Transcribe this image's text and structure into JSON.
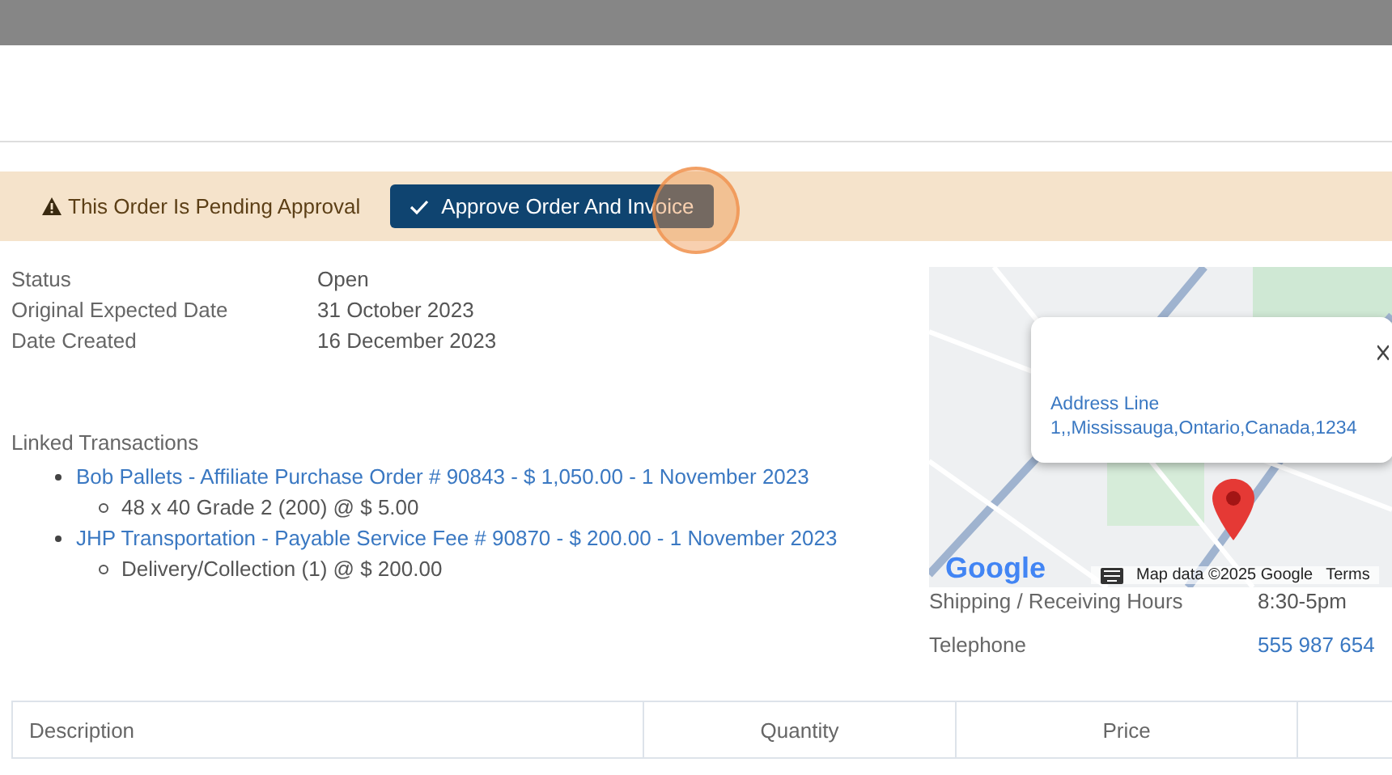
{
  "banner": {
    "message": "This Order Is Pending Approval",
    "button": "Approve Order And Invoice"
  },
  "details": [
    {
      "label": "Status",
      "value": "Open"
    },
    {
      "label": "Original Expected Date",
      "value": "31 October 2023"
    },
    {
      "label": "Date Created",
      "value": "16 December 2023"
    }
  ],
  "linked_transactions": {
    "title": "Linked Transactions",
    "items": [
      {
        "link": "Bob Pallets - Affiliate Purchase Order # 90843 - $ 1,050.00 - 1 November 2023",
        "children": [
          "48 x 40 Grade 2 (200) @ $ 5.00"
        ]
      },
      {
        "link": "JHP Transportation - Payable Service Fee # 90870 - $ 200.00 - 1 November 2023",
        "children": [
          "Delivery/Collection (1) @ $ 200.00"
        ]
      }
    ]
  },
  "map": {
    "popup_address": [
      "Address Line",
      "1,,Mississauga,Ontario,Canada,1234"
    ],
    "logo": "Google",
    "attribution": "Map data ©2025 Google",
    "terms": "Terms"
  },
  "contact": [
    {
      "label": "Shipping / Receiving Hours",
      "value": "8:30-5pm",
      "kind": "text"
    },
    {
      "label": "Telephone",
      "value": "555 987 654",
      "kind": "link"
    }
  ],
  "table": {
    "columns": [
      "Description",
      "Quantity",
      "Price"
    ]
  }
}
